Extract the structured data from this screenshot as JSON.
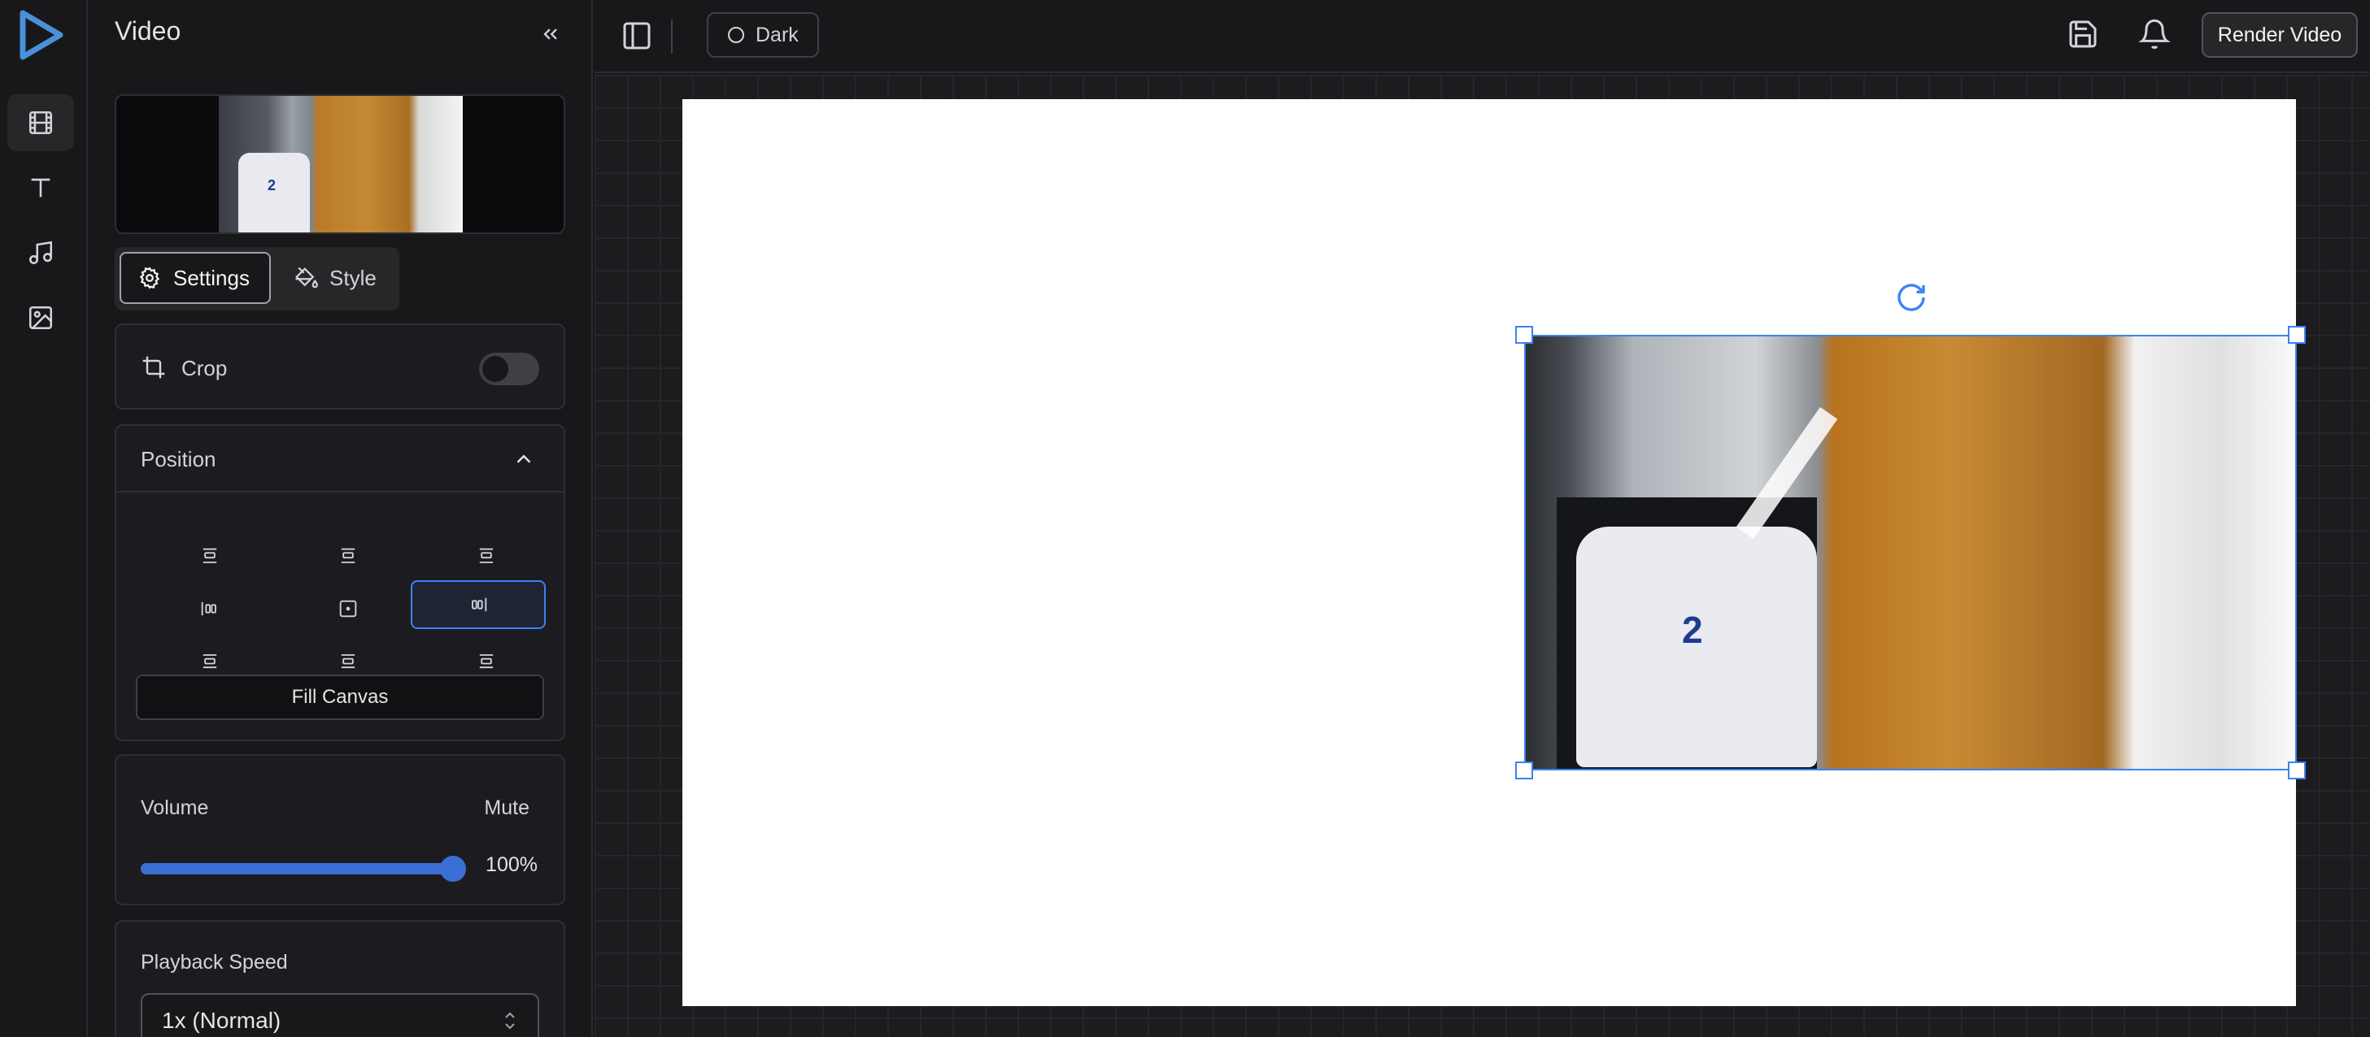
{
  "rail": {
    "items": [
      {
        "icon": "film-icon",
        "active": true
      },
      {
        "icon": "text-icon",
        "active": false
      },
      {
        "icon": "music-icon",
        "active": false
      },
      {
        "icon": "image-icon",
        "active": false
      }
    ]
  },
  "panel": {
    "title": "Video",
    "tabs": [
      {
        "label": "Settings",
        "icon": "gear-icon",
        "active": true
      },
      {
        "label": "Style",
        "icon": "paint-bucket-icon",
        "active": false
      }
    ],
    "crop": {
      "label": "Crop",
      "enabled": false
    },
    "position": {
      "label": "Position",
      "selected": "middle-right",
      "fill_label": "Fill Canvas"
    },
    "volume": {
      "label": "Volume",
      "mute_label": "Mute",
      "value_text": "100%",
      "value": 1.0
    },
    "playback": {
      "label": "Playback Speed",
      "selected": "1x (Normal)"
    }
  },
  "topbar": {
    "theme_label": "Dark",
    "render_label": "Render Video"
  },
  "colors": {
    "accent": "#3b82f6",
    "background": "#18181b",
    "canvas": "#ffffff"
  }
}
